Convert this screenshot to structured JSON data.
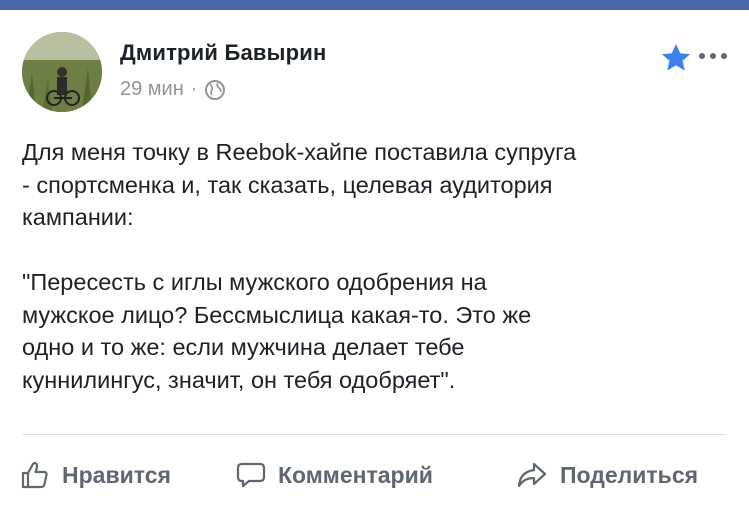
{
  "post": {
    "author": "Дмитрий Бавырин",
    "time": "29 мин",
    "separator": "·",
    "privacy_icon": "globe-icon",
    "paragraphs": [
      "Для меня точку в Reebok-хайпе поставила супруга\n- спортсменка и, так сказать, целевая аудитория\nкампании:",
      "\"Пересесть с иглы мужского одобрения на\nмужское лицо? Бессмыслица какая-то. Это же\nодно и то же: если мужчина делает тебе\nкуннилингус, значит, он тебя одобряет\"."
    ]
  },
  "actions": {
    "like": "Нравится",
    "comment": "Комментарий",
    "share": "Поделиться"
  },
  "colors": {
    "top_bar": "#4a67a8",
    "star": "#3b82f0",
    "action_text": "#606770",
    "meta_text": "#90949c"
  }
}
